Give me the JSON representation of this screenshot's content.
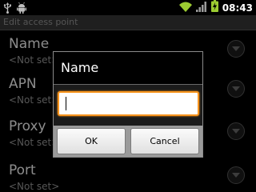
{
  "status_bar": {
    "time": "08:43",
    "icons": [
      "usb-icon",
      "android-debug-icon",
      "wifi-icon",
      "signal-icon",
      "battery-charging-icon"
    ]
  },
  "title_bar": {
    "title": "Edit access point"
  },
  "list": {
    "items": [
      {
        "title": "Name",
        "summary": "<Not set>"
      },
      {
        "title": "APN",
        "summary": "<Not set>"
      },
      {
        "title": "Proxy",
        "summary": "<Not set>"
      },
      {
        "title": "Port",
        "summary": "<Not set>"
      }
    ]
  },
  "dialog": {
    "title": "Name",
    "input_value": "",
    "ok_label": "OK",
    "cancel_label": "Cancel"
  },
  "colors": {
    "accent": "#f7941d",
    "wifi": "#9ccc32",
    "battery": "#9ccc32"
  }
}
